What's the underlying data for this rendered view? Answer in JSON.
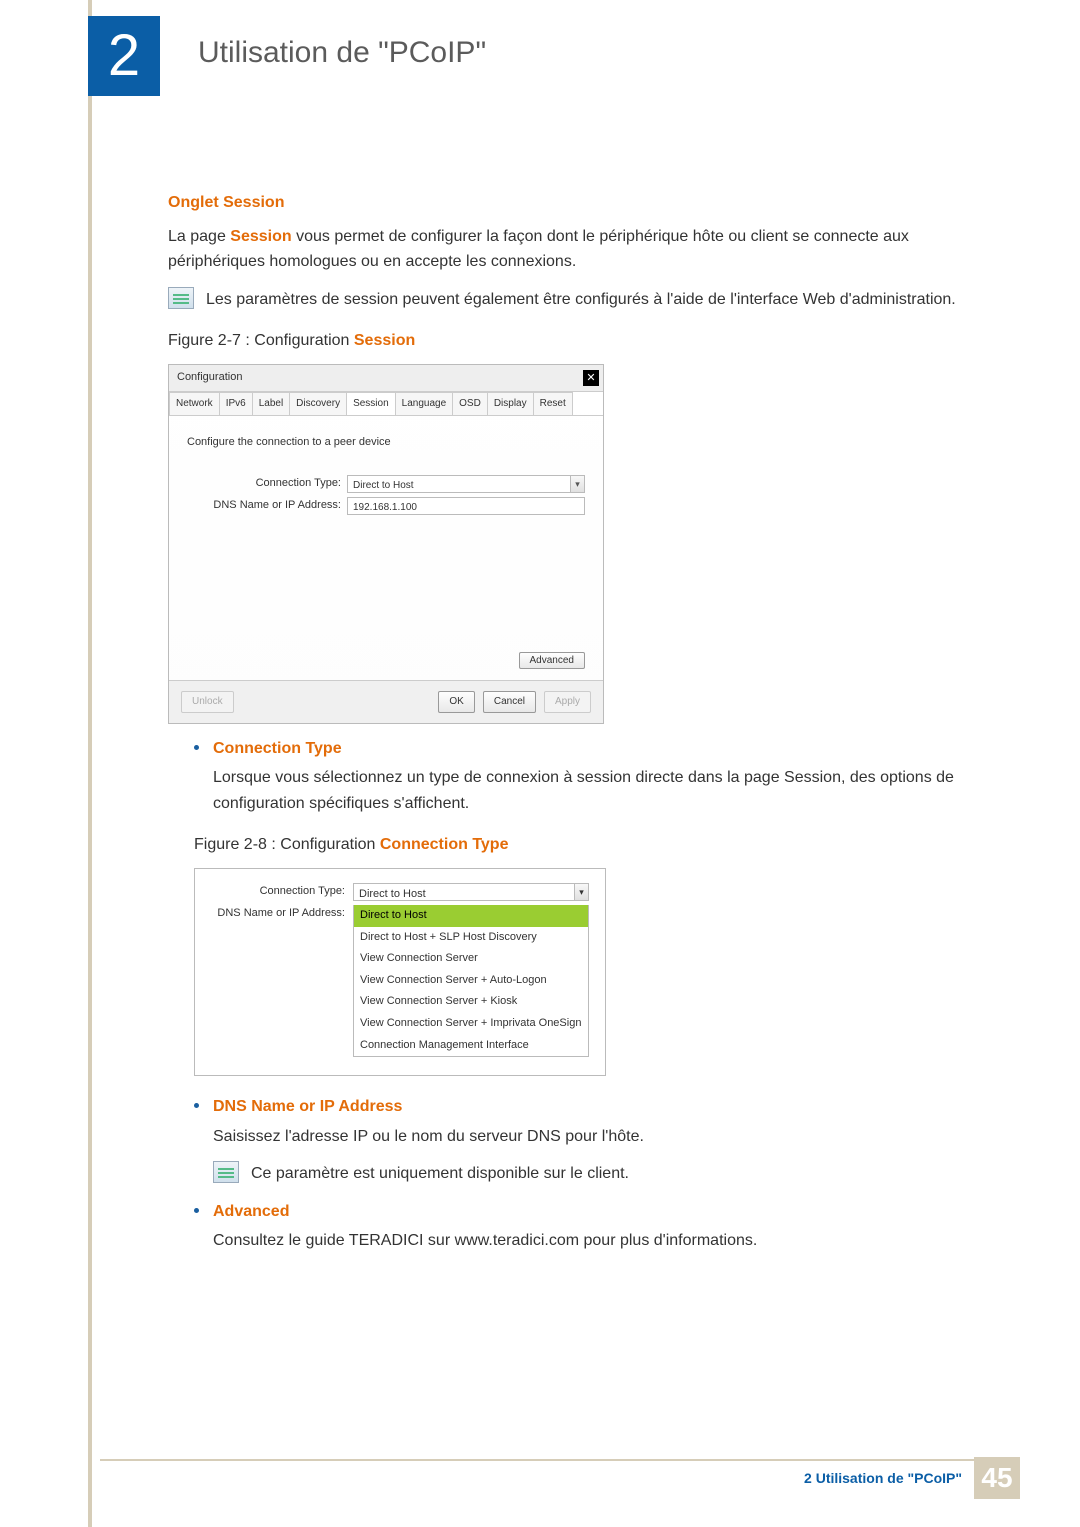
{
  "chapter": {
    "number": "2",
    "title": "Utilisation de \"PCoIP\""
  },
  "section": {
    "heading": "Onglet Session",
    "intro_pre": "La page ",
    "intro_bold": "Session",
    "intro_post": " vous permet de configurer la façon dont le périphérique hôte ou client se connecte aux périphériques homologues ou en accepte les connexions.",
    "note": "Les paramètres de session peuvent également être configurés à l'aide de l'interface Web d'administration."
  },
  "fig27": {
    "label_pre": "Figure 2-7 : Configuration ",
    "label_bold": "Session",
    "window_title": "Configuration",
    "tabs": [
      "Network",
      "IPv6",
      "Label",
      "Discovery",
      "Session",
      "Language",
      "OSD",
      "Display",
      "Reset"
    ],
    "active_tab_index": 4,
    "desc": "Configure the connection to a peer device",
    "conn_type_label": "Connection Type:",
    "conn_type_value": "Direct to Host",
    "dns_label": "DNS Name or IP Address:",
    "dns_value": "192.168.1.100",
    "advanced_btn": "Advanced",
    "unlock_btn": "Unlock",
    "ok_btn": "OK",
    "cancel_btn": "Cancel",
    "apply_btn": "Apply"
  },
  "conn_type_section": {
    "heading": "Connection Type",
    "text": "Lorsque vous sélectionnez un type de connexion à session directe dans la page Session, des options de configuration spécifiques s'affichent."
  },
  "fig28": {
    "label_pre": "Figure 2-8 : Configuration ",
    "label_bold": "Connection Type",
    "conn_type_label": "Connection Type:",
    "conn_type_value": "Direct to Host",
    "dns_label": "DNS Name or IP Address:",
    "options": [
      "Direct to Host",
      "Direct to Host + SLP Host Discovery",
      "View Connection Server",
      "View Connection Server + Auto-Logon",
      "View Connection Server + Kiosk",
      "View Connection Server + Imprivata OneSign",
      "Connection Management Interface"
    ],
    "selected_index": 0
  },
  "dns_section": {
    "heading": "DNS Name or IP Address",
    "text": "Saisissez l'adresse IP ou le nom du serveur DNS pour l'hôte.",
    "note": "Ce paramètre est uniquement disponible sur le client."
  },
  "advanced_section": {
    "heading": "Advanced",
    "text": "Consultez le guide TERADICI sur www.teradici.com pour plus d'informations."
  },
  "footer": {
    "label": "2 Utilisation de \"PCoIP\"",
    "page": "45"
  }
}
